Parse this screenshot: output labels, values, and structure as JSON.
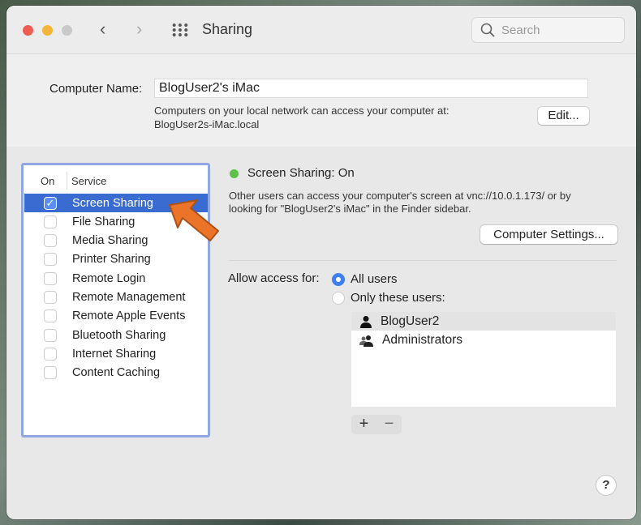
{
  "window": {
    "title": "Sharing",
    "search_placeholder": "Search"
  },
  "computer_name": {
    "label": "Computer Name:",
    "value": "BlogUser2's iMac",
    "info_line1": "Computers on your local network can access your computer at:",
    "info_line2": "BlogUser2s-iMac.local",
    "edit_button": "Edit..."
  },
  "services": {
    "col_on": "On",
    "col_service": "Service",
    "items": [
      {
        "name": "Screen Sharing",
        "on": true
      },
      {
        "name": "File Sharing",
        "on": false
      },
      {
        "name": "Media Sharing",
        "on": false
      },
      {
        "name": "Printer Sharing",
        "on": false
      },
      {
        "name": "Remote Login",
        "on": false
      },
      {
        "name": "Remote Management",
        "on": false
      },
      {
        "name": "Remote Apple Events",
        "on": false
      },
      {
        "name": "Bluetooth Sharing",
        "on": false
      },
      {
        "name": "Internet Sharing",
        "on": false
      },
      {
        "name": "Content Caching",
        "on": false
      }
    ]
  },
  "detail": {
    "status": "Screen Sharing: On",
    "status_color": "#5cc24a",
    "desc_line1": "Other users can access your computer's screen at vnc://10.0.1.173/ or by",
    "desc_line2": "looking for \"BlogUser2's iMac\" in the Finder sidebar.",
    "settings_button": "Computer Settings...",
    "allow_label": "Allow access for:",
    "radio_all": "All users",
    "radio_only": "Only these users:",
    "users": [
      "BlogUser2",
      "Administrators"
    ],
    "add": "+",
    "remove": "−"
  },
  "help": "?"
}
